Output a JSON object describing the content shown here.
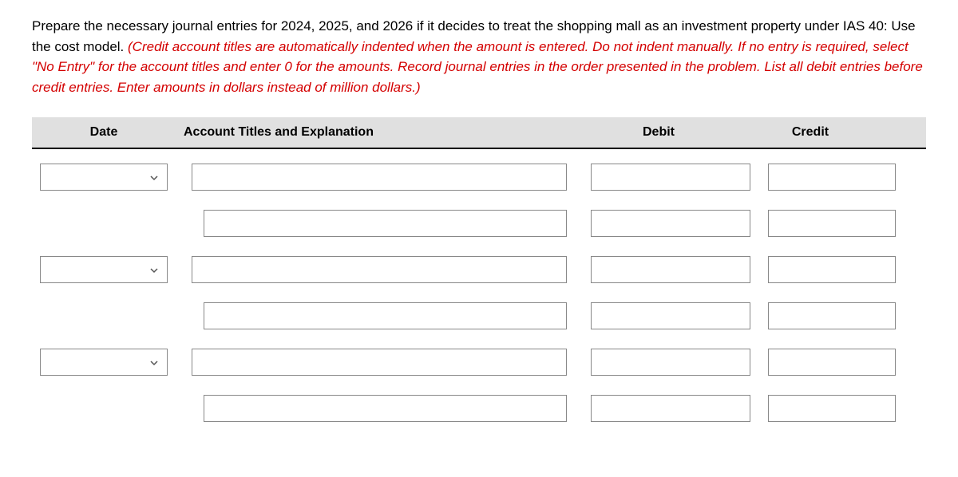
{
  "instructions": {
    "main_text": "Prepare the necessary journal entries for 2024, 2025, and 2026 if it decides to treat the shopping mall as an investment property under IAS 40: Use the cost model. ",
    "red_text": "(Credit account titles are automatically indented when the amount is entered. Do not indent manually. If no entry is required, select \"No Entry\" for the account titles and enter 0 for the amounts. Record journal entries in the order presented in the problem. List all debit entries before credit entries. Enter amounts in dollars instead of million dollars.)"
  },
  "headers": {
    "date": "Date",
    "account": "Account Titles and Explanation",
    "debit": "Debit",
    "credit": "Credit"
  },
  "rows": [
    {
      "has_date": true,
      "date_value": "",
      "account_value": "",
      "debit_value": "",
      "credit_value": "",
      "indented": false
    },
    {
      "has_date": false,
      "date_value": "",
      "account_value": "",
      "debit_value": "",
      "credit_value": "",
      "indented": true
    },
    {
      "has_date": true,
      "date_value": "",
      "account_value": "",
      "debit_value": "",
      "credit_value": "",
      "indented": false
    },
    {
      "has_date": false,
      "date_value": "",
      "account_value": "",
      "debit_value": "",
      "credit_value": "",
      "indented": true
    },
    {
      "has_date": true,
      "date_value": "",
      "account_value": "",
      "debit_value": "",
      "credit_value": "",
      "indented": false
    },
    {
      "has_date": false,
      "date_value": "",
      "account_value": "",
      "debit_value": "",
      "credit_value": "",
      "indented": true
    }
  ]
}
